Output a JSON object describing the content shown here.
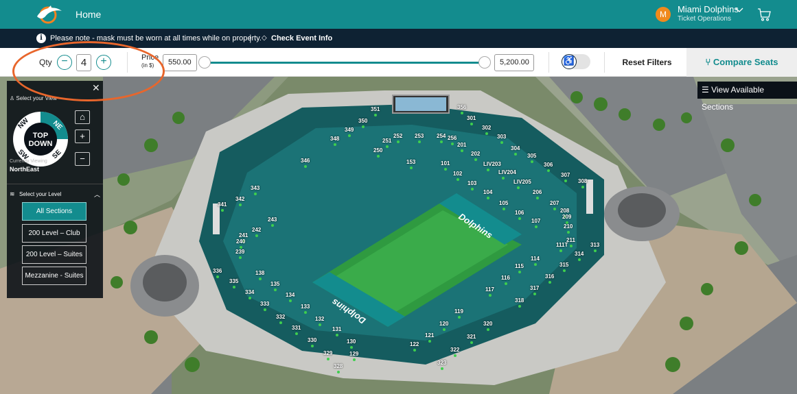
{
  "header": {
    "home_label": "Home",
    "avatar_initial": "M",
    "account_name": "Miami Dolphins",
    "account_role": "Ticket Operations",
    "logo_icon": "dolphins-logo-icon",
    "cart_icon": "cart-icon"
  },
  "notice": {
    "message": "Please note - mask must be worn at all times while on property.",
    "separator": "|",
    "link": "Check Event Info"
  },
  "filters": {
    "qty_label": "Qty",
    "qty_value": "4",
    "minus": "−",
    "plus": "+",
    "price_label": "Price",
    "price_sub": "(in $)",
    "price_min": "550.00",
    "price_max": "5,200.00",
    "accessibility_icon": "♿",
    "reset_label": "Reset Filters",
    "compare_label": "Compare Seats",
    "compare_icon": "seat-icon"
  },
  "map": {
    "view_available_label": "View Available Sections",
    "field_text_top": "Dolphins",
    "field_text_bottom": "Dolphins",
    "sections": [
      {
        "id": "351"
      },
      {
        "id": "350"
      },
      {
        "id": "349"
      },
      {
        "id": "348"
      },
      {
        "id": "356"
      },
      {
        "id": "252"
      },
      {
        "id": "253"
      },
      {
        "id": "254"
      },
      {
        "id": "256"
      },
      {
        "id": "251"
      },
      {
        "id": "250"
      },
      {
        "id": "201"
      },
      {
        "id": "301"
      },
      {
        "id": "302"
      },
      {
        "id": "303"
      },
      {
        "id": "304"
      },
      {
        "id": "305"
      },
      {
        "id": "306"
      },
      {
        "id": "307"
      },
      {
        "id": "308"
      },
      {
        "id": "202"
      },
      {
        "id": "LIV203"
      },
      {
        "id": "LIV204"
      },
      {
        "id": "LIV205"
      },
      {
        "id": "206"
      },
      {
        "id": "207"
      },
      {
        "id": "208"
      },
      {
        "id": "209"
      },
      {
        "id": "210"
      },
      {
        "id": "211"
      },
      {
        "id": "111T"
      },
      {
        "id": "313"
      },
      {
        "id": "314"
      },
      {
        "id": "315"
      },
      {
        "id": "316"
      },
      {
        "id": "317"
      },
      {
        "id": "318"
      },
      {
        "id": "320"
      },
      {
        "id": "321"
      },
      {
        "id": "322"
      },
      {
        "id": "323"
      },
      {
        "id": "153"
      },
      {
        "id": "101"
      },
      {
        "id": "102"
      },
      {
        "id": "103"
      },
      {
        "id": "104"
      },
      {
        "id": "105"
      },
      {
        "id": "106"
      },
      {
        "id": "107"
      },
      {
        "id": "114"
      },
      {
        "id": "115"
      },
      {
        "id": "116"
      },
      {
        "id": "117"
      },
      {
        "id": "119"
      },
      {
        "id": "120"
      },
      {
        "id": "121"
      },
      {
        "id": "122"
      },
      {
        "id": "129"
      },
      {
        "id": "130"
      },
      {
        "id": "131"
      },
      {
        "id": "132"
      },
      {
        "id": "133"
      },
      {
        "id": "134"
      },
      {
        "id": "135"
      },
      {
        "id": "138"
      },
      {
        "id": "346"
      },
      {
        "id": "343"
      },
      {
        "id": "342"
      },
      {
        "id": "341"
      },
      {
        "id": "243"
      },
      {
        "id": "242"
      },
      {
        "id": "241"
      },
      {
        "id": "240"
      },
      {
        "id": "239"
      },
      {
        "id": "336"
      },
      {
        "id": "335"
      },
      {
        "id": "334"
      },
      {
        "id": "333"
      },
      {
        "id": "332"
      },
      {
        "id": "331"
      },
      {
        "id": "330"
      },
      {
        "id": "329"
      },
      {
        "id": "328"
      }
    ]
  },
  "view_panel": {
    "select_view_label": "Select your View",
    "dial_center": "TOP\nDOWN",
    "dial_nw": "NW",
    "dial_ne": "NE",
    "dial_sw": "SW",
    "dial_se": "SE",
    "home_icon": "home-icon",
    "zoom_in": "+",
    "zoom_out": "−",
    "currently_viewing_label": "Currently Viewing",
    "currently_viewing_value": "NorthEast",
    "select_level_label": "Select your Level",
    "levels": [
      "All Sections",
      "200 Level – Club",
      "200 Level – Suites",
      "Mezzanine - Suites"
    ],
    "active_level": "All Sections"
  },
  "colors": {
    "primary": "#138c8e",
    "navy": "#0e2233",
    "orange": "#f08a1c",
    "annotation": "#e8662c"
  }
}
